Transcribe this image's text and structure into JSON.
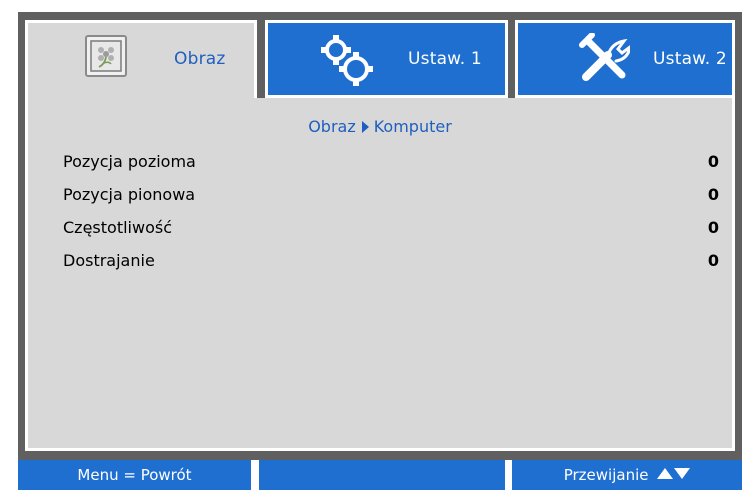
{
  "tabs": [
    {
      "label": "Obraz",
      "icon": "picture-icon",
      "active": true
    },
    {
      "label": "Ustaw. 1",
      "icon": "gears-icon",
      "active": false
    },
    {
      "label": "Ustaw. 2",
      "icon": "tools-icon",
      "active": false
    }
  ],
  "breadcrumb": {
    "parent": "Obraz",
    "current": "Komputer"
  },
  "items": [
    {
      "label": "Pozycja pozioma",
      "value": "0"
    },
    {
      "label": "Pozycja pionowa",
      "value": "0"
    },
    {
      "label": "Częstotliwość",
      "value": "0"
    },
    {
      "label": "Dostrajanie",
      "value": "0"
    }
  ],
  "footer": {
    "left": "Menu = Powrót",
    "middle": "",
    "right": "Przewijanie"
  },
  "colors": {
    "accent_blue": "#1f6fd0",
    "panel_grey": "#d8d8d8",
    "frame_grey": "#606060",
    "text_blue": "#1f5fbf"
  }
}
